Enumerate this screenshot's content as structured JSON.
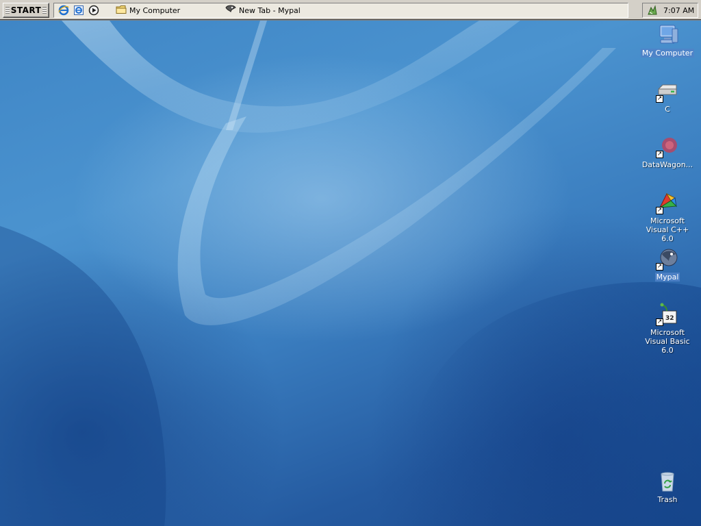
{
  "taskbar": {
    "start_label": "START",
    "quick_launch": [
      {
        "icon": "internet-explorer-icon"
      },
      {
        "icon": "ie-page-icon"
      },
      {
        "icon": "media-player-icon"
      }
    ],
    "tasks": [
      {
        "label": "My Computer",
        "icon": "folder-icon"
      },
      {
        "label": "New Tab - Mypal",
        "icon": "mypal-icon"
      }
    ],
    "clock": "7:07 AM"
  },
  "desktop": {
    "icons": [
      {
        "label": "My Computer",
        "icon": "my-computer-icon",
        "selected": true
      },
      {
        "label": "C",
        "icon": "drive-icon"
      },
      {
        "label": "DataWagon...",
        "icon": "datawagon-icon"
      },
      {
        "label": "Microsoft Visual C++ 6.0",
        "icon": "visual-cpp-icon"
      },
      {
        "label": "Mypal",
        "icon": "mypal-icon",
        "selected": true
      },
      {
        "label": "Microsoft Visual Basic 6.0",
        "icon": "visual-basic-icon"
      },
      {
        "label": "Trash",
        "icon": "trash-icon"
      }
    ]
  },
  "colors": {
    "taskbar": "#d4d0c8",
    "desktop": "#3a7dbf",
    "selection": "#5082c8"
  }
}
